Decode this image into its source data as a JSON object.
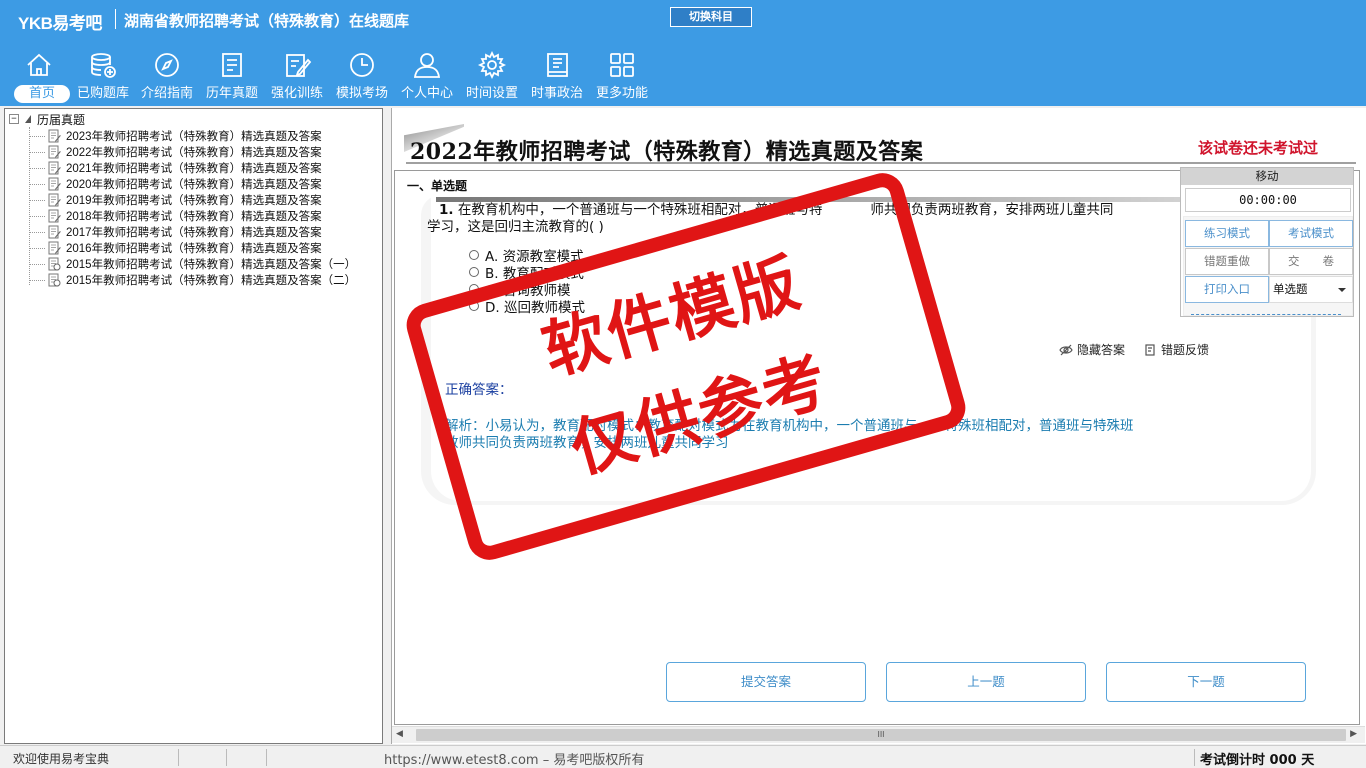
{
  "header": {
    "logo": "YKB易考吧",
    "title": "湖南省教师招聘考试（特殊教育）在线题库",
    "switch_subject": "切换科目"
  },
  "nav": [
    {
      "label": "首页",
      "icon": "home-icon"
    },
    {
      "label": "已购题库",
      "icon": "database-icon"
    },
    {
      "label": "介绍指南",
      "icon": "compass-icon"
    },
    {
      "label": "历年真题",
      "icon": "list-icon"
    },
    {
      "label": "强化训练",
      "icon": "edit-icon"
    },
    {
      "label": "模拟考场",
      "icon": "clock-icon"
    },
    {
      "label": "个人中心",
      "icon": "user-icon"
    },
    {
      "label": "时间设置",
      "icon": "gear-icon"
    },
    {
      "label": "时事政治",
      "icon": "book-icon"
    },
    {
      "label": "更多功能",
      "icon": "grid-icon"
    }
  ],
  "tree": {
    "root_label": "历届真题",
    "items": [
      "2023年教师招聘考试（特殊教育）精选真题及答案",
      "2022年教师招聘考试（特殊教育）精选真题及答案",
      "2021年教师招聘考试（特殊教育）精选真题及答案",
      "2020年教师招聘考试（特殊教育）精选真题及答案",
      "2019年教师招聘考试（特殊教育）精选真题及答案",
      "2018年教师招聘考试（特殊教育）精选真题及答案",
      "2017年教师招聘考试（特殊教育）精选真题及答案",
      "2016年教师招聘考试（特殊教育）精选真题及答案",
      "2015年教师招聘考试（特殊教育）精选真题及答案（一）",
      "2015年教师招聘考试（特殊教育）精选真题及答案（二）"
    ]
  },
  "exam": {
    "title": "2022年教师招聘考试（特殊教育）精选真题及答案",
    "status": "该试卷还未考试过",
    "section": "一、单选题",
    "question_number": "1.",
    "question_text": "在教育机构中，一个普通班与一个特殊班相配对，普通班与特",
    "question_text_tail": "师共同负责两班教育，安排两班儿童共同",
    "question_text_line2": "学习，这是回归主流教育的(  )",
    "options": [
      "A. 资源教室模式",
      "B. 教育配对模式",
      "C. 咨询教师模",
      "D. 巡回教师模式"
    ],
    "hide_answer": "隐藏答案",
    "report_error": "错题反馈",
    "answer_label": "正确答案：",
    "analysis_line1": "解析：小易认为，教育配对模式：教育配对模式为在教育机构中，一个普通班与一个特殊班相配对，普通班与特殊班",
    "analysis_line2": "教师共同负责两班教育，安排两班儿童共同学习"
  },
  "buttons": {
    "submit": "提交答案",
    "prev": "上一题",
    "next": "下一题"
  },
  "control": {
    "move": "移动",
    "timer": "00:00:00",
    "practice_mode": "练习模式",
    "exam_mode": "考试模式",
    "redo_wrong": "错题重做",
    "hand_in": "交　　卷",
    "print": "打印入口",
    "question_type": "单选题"
  },
  "stamp": {
    "line1": "软件模版",
    "line2": "仅供参考"
  },
  "statusbar": {
    "welcome": "欢迎使用易考宝典",
    "url": "https://www.etest8.com – 易考吧版权所有",
    "countdown": "考试倒计时 000 天"
  },
  "colors": {
    "header_bg": "#3d9be4",
    "status_red": "#d0142c",
    "stamp_red": "#e01515",
    "analysis_blue": "#1c7db0"
  }
}
